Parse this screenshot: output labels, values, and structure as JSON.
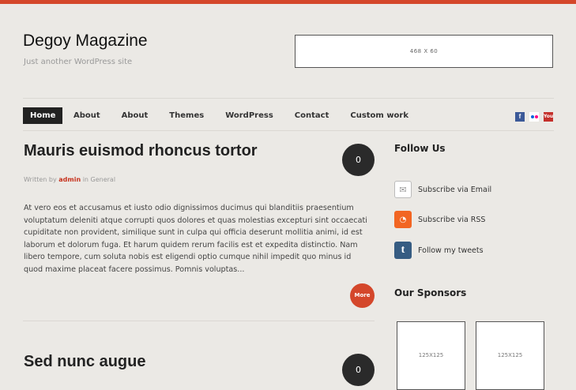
{
  "site": {
    "title": "Degoy Magazine",
    "tagline": "Just another WordPress site",
    "header_ad": "468 X 60",
    "accent": "#d4472b"
  },
  "nav": {
    "items": [
      {
        "label": "Home",
        "active": true
      },
      {
        "label": "About"
      },
      {
        "label": "About"
      },
      {
        "label": "Themes"
      },
      {
        "label": "WordPress"
      },
      {
        "label": "Contact"
      },
      {
        "label": "Custom work"
      }
    ],
    "social": [
      {
        "name": "facebook-icon",
        "glyph": "f"
      },
      {
        "name": "flickr-icon",
        "glyph": "••"
      },
      {
        "name": "youtube-icon",
        "glyph": "You"
      }
    ]
  },
  "posts": [
    {
      "title": "Mauris euismod rhoncus tortor",
      "comments": "0",
      "meta_prefix": "Written by",
      "author": "admin",
      "meta_in": "in",
      "category": "General",
      "excerpt": "At vero eos et accusamus et iusto odio dignissimos ducimus qui blanditiis praesentium voluptatum deleniti atque corrupti quos dolores et quas molestias excepturi sint occaecati cupiditate non provident, similique sunt in culpa qui officia deserunt mollitia animi, id est laborum et dolorum fuga. Et harum quidem rerum facilis est et expedita distinctio. Nam libero tempore, cum soluta nobis est eligendi optio cumque nihil impedit quo minus id quod maxime placeat facere possimus. Pomnis voluptas...",
      "more_label": "More"
    },
    {
      "title": "Sed nunc augue",
      "comments": "0"
    }
  ],
  "sidebar": {
    "follow_title": "Follow Us",
    "subscriptions": [
      {
        "label": "Subscribe via Email",
        "icon": "email-icon"
      },
      {
        "label": "Subscribe via RSS",
        "icon": "rss-icon"
      },
      {
        "label": "Follow my tweets",
        "icon": "twitter-icon"
      }
    ],
    "sponsors_title": "Our Sponsors",
    "sponsor_ads": [
      "125X125",
      "125X125"
    ]
  }
}
